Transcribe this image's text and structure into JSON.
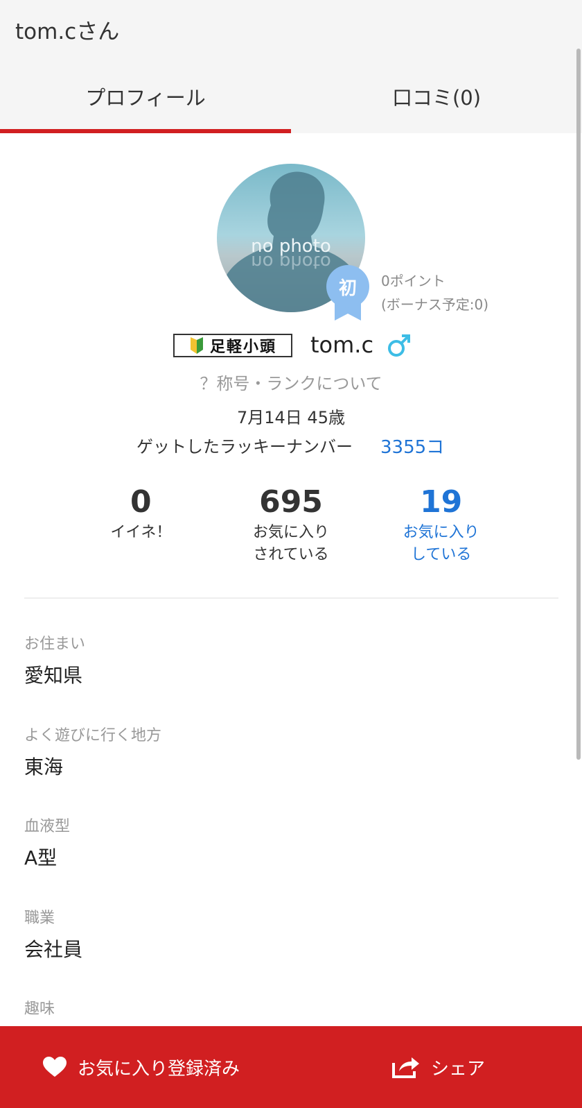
{
  "header": {
    "title": "tom.cさん"
  },
  "tabs": [
    {
      "label": "プロフィール",
      "active": true
    },
    {
      "label": "口コミ(0)",
      "active": false
    }
  ],
  "profile": {
    "avatar_text": "no photo",
    "badge_text": "初",
    "points": "0ポイント",
    "bonus": "(ボーナス予定:0)",
    "rank_title": "足軽小頭",
    "username": "tom.c",
    "gender_icon": "male-symbol-icon",
    "rank_link": "？称号・ランクについて",
    "birthday_age": "7月14日 45歳",
    "lucky_label": "ゲットしたラッキーナンバー",
    "lucky_count": "3355コ"
  },
  "stats": [
    {
      "value": "0",
      "label1": "イイネ！",
      "label2": ""
    },
    {
      "value": "695",
      "label1": "お気に入り",
      "label2": "されている"
    },
    {
      "value": "19",
      "label1": "お気に入り",
      "label2": "している"
    }
  ],
  "details": [
    {
      "key": "お住まい",
      "value": "愛知県"
    },
    {
      "key": "よく遊びに行く地方",
      "value": "東海"
    },
    {
      "key": "血液型",
      "value": "A型"
    },
    {
      "key": "職業",
      "value": "会社員"
    },
    {
      "key": "趣味",
      "value": ""
    }
  ],
  "bottom": {
    "favorite_label": "お気に入り登録済み",
    "share_label": "シェア"
  },
  "colors": {
    "accent_red": "#d11f21",
    "link_blue": "#1f74d6",
    "badge_blue": "#8dbef0",
    "gender_cyan": "#3dbde6"
  }
}
